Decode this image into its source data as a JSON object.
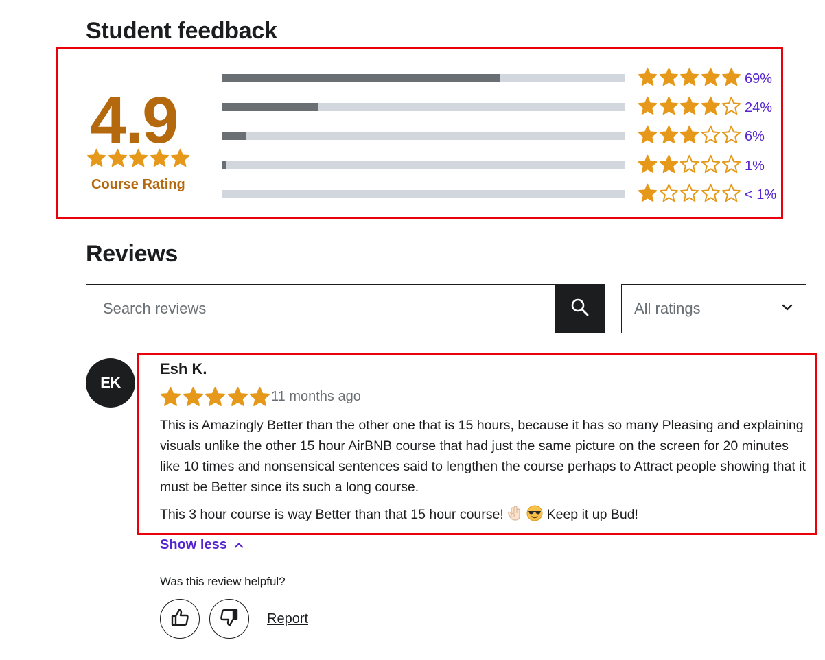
{
  "feedback": {
    "title": "Student feedback",
    "average": "4.9",
    "average_label": "Course Rating",
    "rows": [
      {
        "stars": 5,
        "percent_label": "69%",
        "fill": 0.69
      },
      {
        "stars": 4,
        "percent_label": "24%",
        "fill": 0.24
      },
      {
        "stars": 3,
        "percent_label": "6%",
        "fill": 0.06
      },
      {
        "stars": 2,
        "percent_label": "1%",
        "fill": 0.01
      },
      {
        "stars": 1,
        "percent_label": "< 1%",
        "fill": 0.0
      }
    ]
  },
  "reviews": {
    "title": "Reviews",
    "search_placeholder": "Search reviews",
    "filter_label": "All ratings"
  },
  "review": {
    "initials": "EK",
    "name": "Esh K.",
    "rating": 5,
    "time": "11 months ago",
    "paragraph1": "This is Amazingly Better than the other one that is 15 hours, because it has so many Pleasing and explaining visuals unlike the other 15 hour AirBNB course that had just the same picture on the screen for 20 minutes like 10 times and nonsensical sentences said to lengthen the course perhaps to Attract people showing that it must be Better since its such a long course.",
    "paragraph2_before": "This 3 hour course is way Better than that 15 hour course! ",
    "paragraph2_after": " Keep it up Bud!",
    "show_less": "Show less",
    "helpful_question": "Was this review helpful?",
    "report": "Report"
  },
  "colors": {
    "star": "#e59819",
    "rating_text": "#b4690e",
    "link": "#5624d0",
    "highlight": "#e8000b"
  }
}
